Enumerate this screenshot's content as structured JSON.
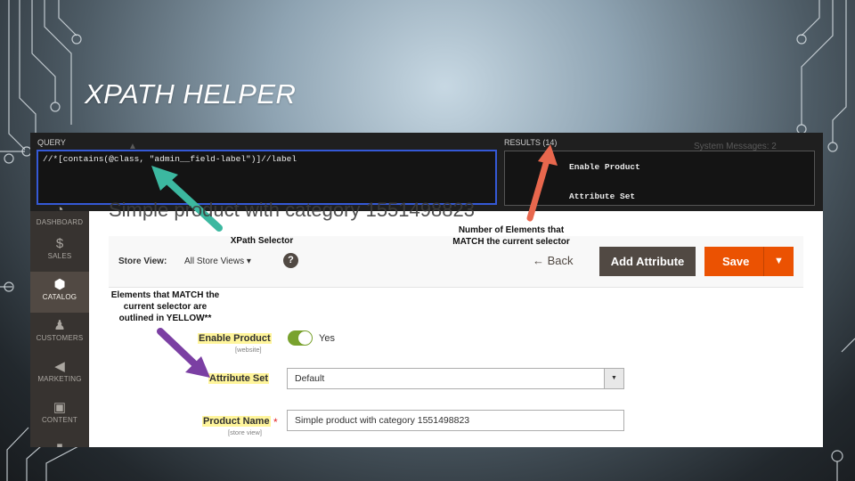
{
  "slide": {
    "title": "XPATH HELPER"
  },
  "helper": {
    "query_label": "QUERY",
    "query_value": "//*[contains(@class, \"admin__field-label\")]//label",
    "results_label": "RESULTS (14)",
    "results": [
      "Enable Product",
      "Attribute Set"
    ]
  },
  "background_text": {
    "page_title": "Simple product with category 1551498823",
    "system_messages": "System Messages: 2"
  },
  "menu": {
    "items": [
      {
        "label": "DASHBOARD",
        "icon": "dashboard-icon",
        "glyph": "◔"
      },
      {
        "label": "SALES",
        "icon": "dollar-icon",
        "glyph": "$"
      },
      {
        "label": "CATALOG",
        "icon": "cube-icon",
        "glyph": "⬢"
      },
      {
        "label": "CUSTOMERS",
        "icon": "person-icon",
        "glyph": "♟"
      },
      {
        "label": "MARKETING",
        "icon": "megaphone-icon",
        "glyph": "◀"
      },
      {
        "label": "CONTENT",
        "icon": "content-icon",
        "glyph": "▣"
      },
      {
        "label": "",
        "icon": "reports-icon",
        "glyph": "▮"
      }
    ],
    "active": "CATALOG"
  },
  "actions": {
    "store_view_label": "Store View:",
    "store_view_value": "All Store Views ▾",
    "help": "?",
    "back_label": "←  Back",
    "add_attribute_label": "Add Attribute",
    "save_label": "Save",
    "save_caret": "▼"
  },
  "form": {
    "enable_product": {
      "label": "Enable Product",
      "scope": "[website]",
      "value": "Yes",
      "enabled": true
    },
    "attribute_set": {
      "label": "Attribute Set",
      "value": "Default",
      "arrow": "▼"
    },
    "product_name": {
      "label": "Product Name",
      "scope": "[store view]",
      "required": "*",
      "value": "Simple product with category 1551498823"
    }
  },
  "annotations": {
    "xpath_selector": "XPath Selector",
    "num_elements": "Number of Elements that\nMATCH the current selector",
    "elements_match": "Elements that MATCH the\ncurrent selector are\noutlined in YELLOW**"
  },
  "colors": {
    "teal_arrow": "#3cb8a0",
    "red_arrow": "#e8674d",
    "purple_arrow": "#7b3fa3",
    "save_orange": "#eb5202",
    "highlight_yellow": "#fff59b"
  }
}
